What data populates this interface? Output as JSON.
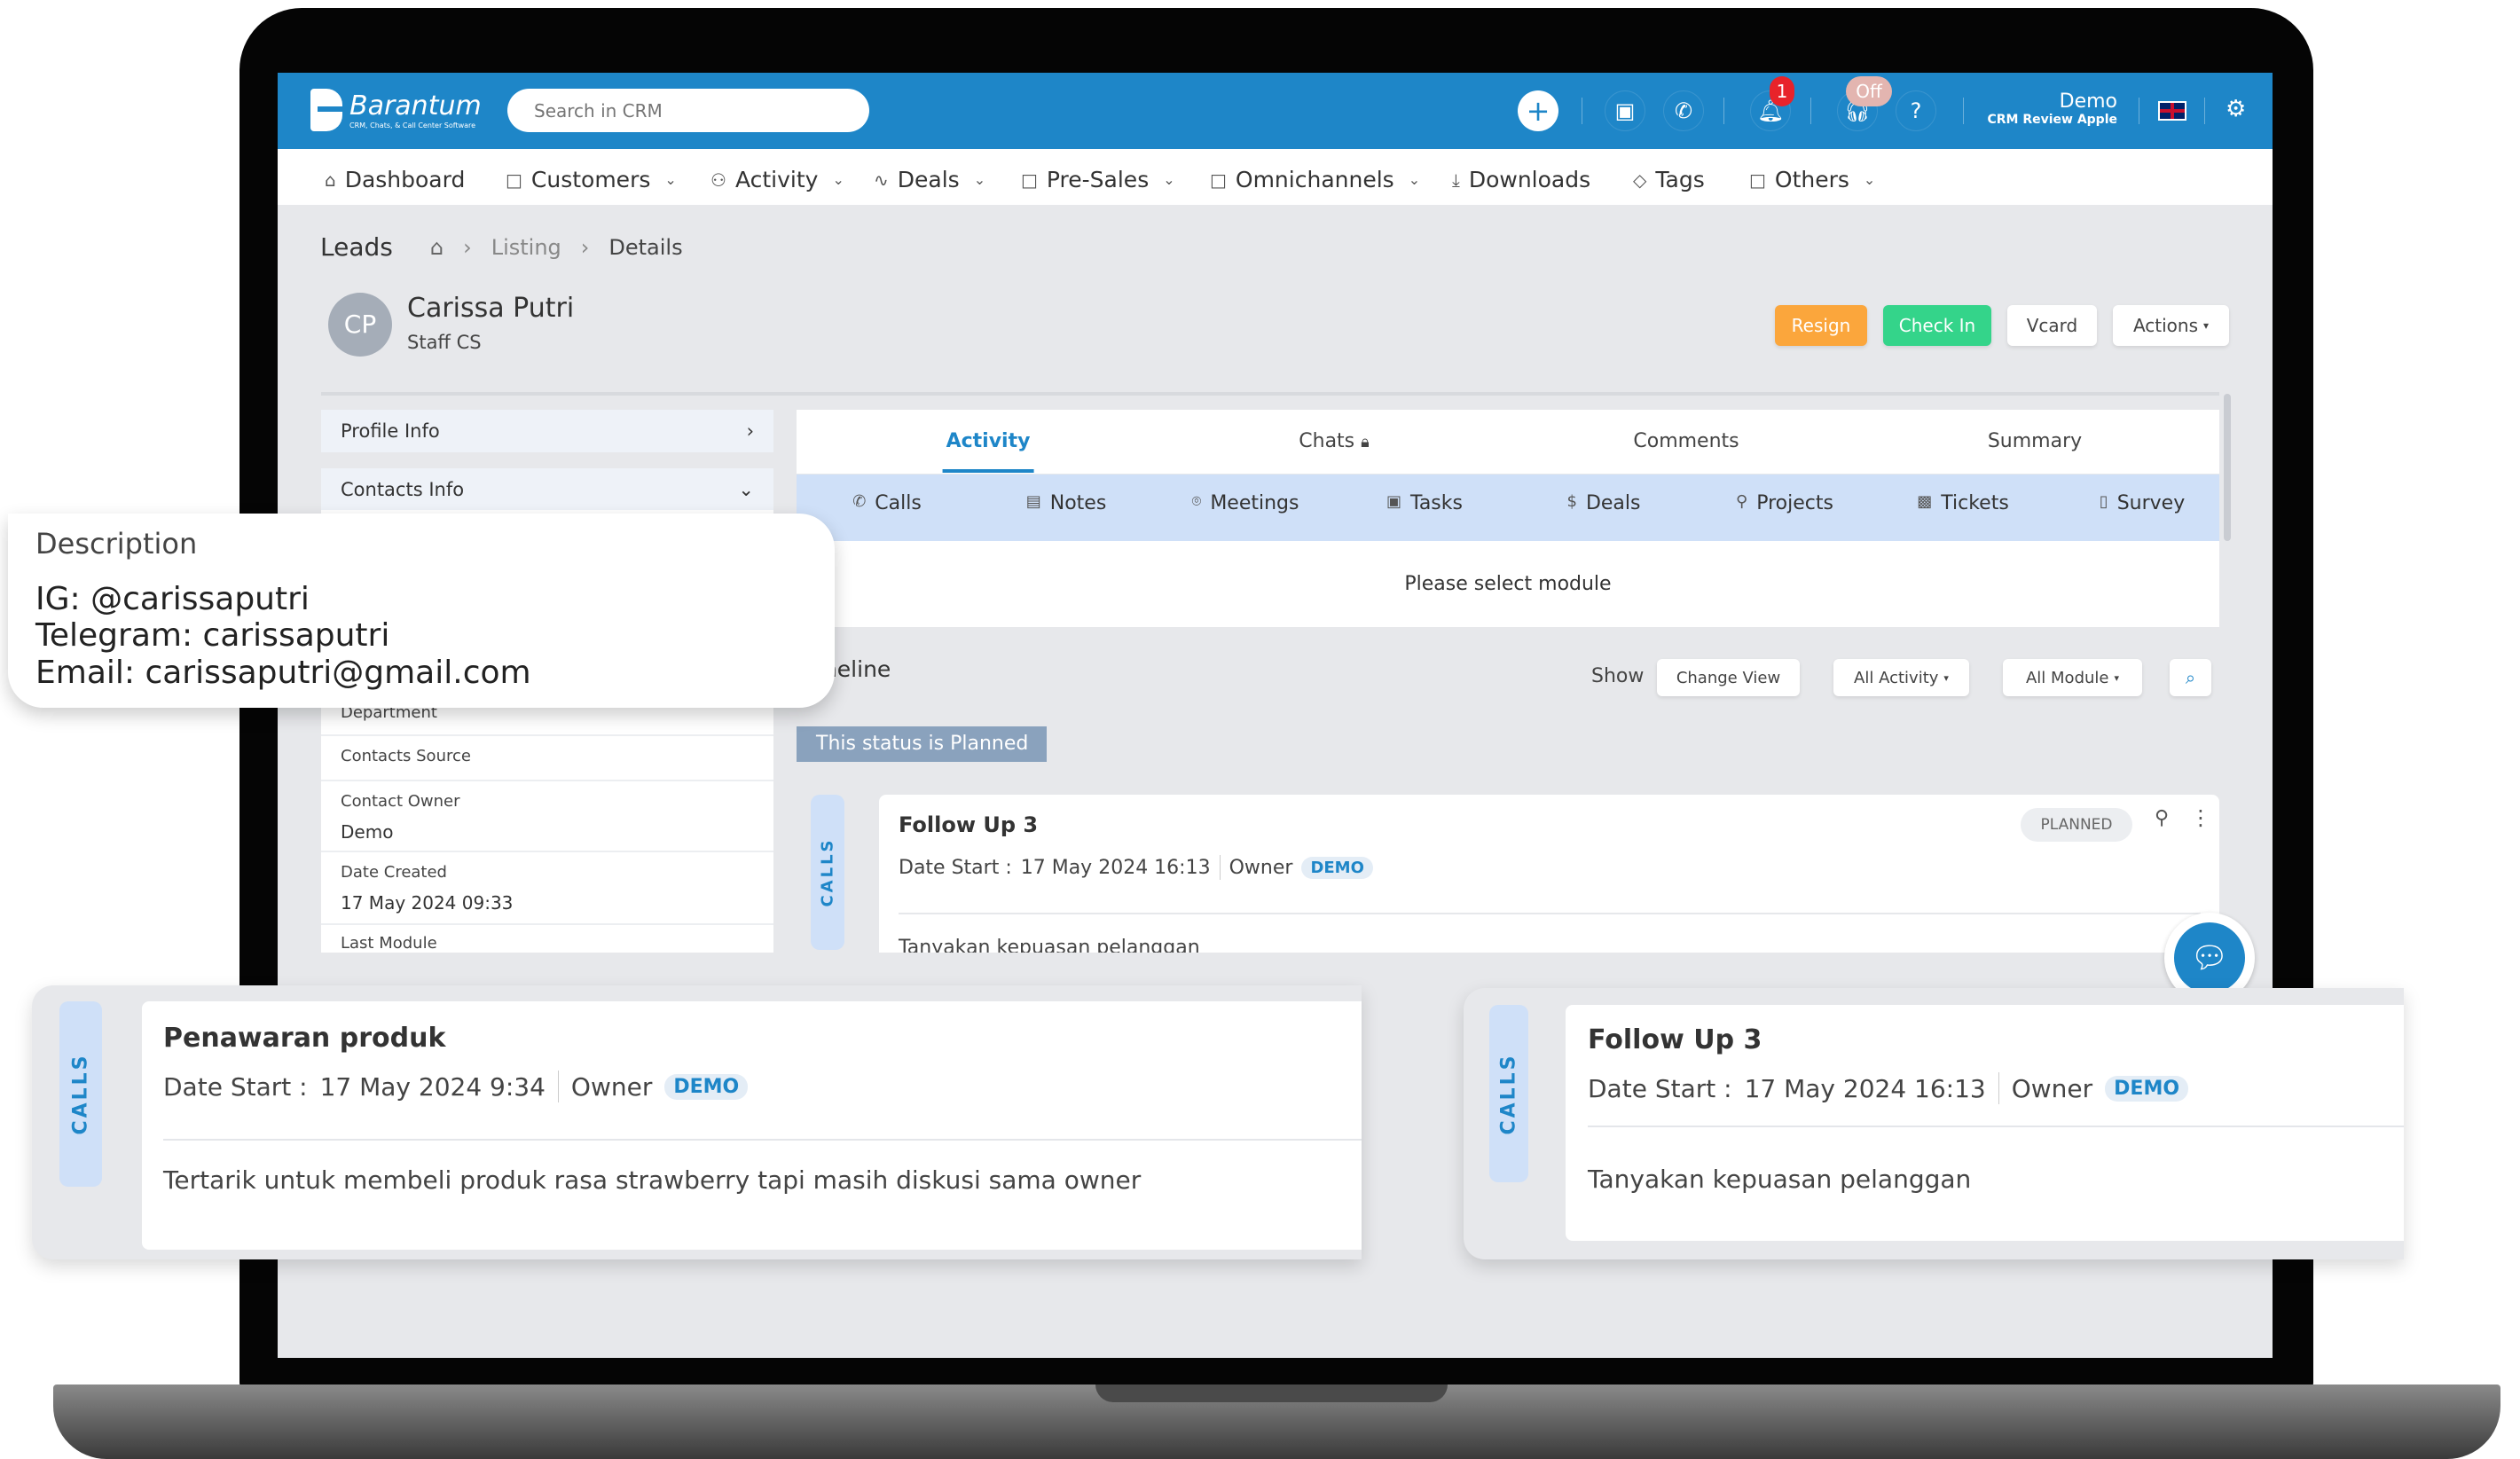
{
  "header": {
    "brand": "Barantum",
    "brand_tagline": "CRM, Chats, & Call Center Software",
    "search_placeholder": "Search in CRM",
    "notification_count": "1",
    "agent_status": "Off",
    "user_name": "Demo",
    "user_company": "CRM Review Apple",
    "accent": "#1e86c8"
  },
  "nav": {
    "items": [
      {
        "label": "Dashboard",
        "icon": "home-icon"
      },
      {
        "label": "Customers",
        "icon": "folder-icon"
      },
      {
        "label": "Activity",
        "icon": "users-icon"
      },
      {
        "label": "Deals",
        "icon": "pulse-icon"
      },
      {
        "label": "Pre-Sales",
        "icon": "folder-icon"
      },
      {
        "label": "Omnichannels",
        "icon": "folder-icon"
      },
      {
        "label": "Downloads",
        "icon": "download-icon"
      },
      {
        "label": "Tags",
        "icon": "tag-icon"
      },
      {
        "label": "Others",
        "icon": "folder-icon"
      }
    ]
  },
  "breadcrumb": {
    "section": "Leads",
    "listing": "Listing",
    "details": "Details"
  },
  "contact": {
    "initials": "CP",
    "name": "Carissa Putri",
    "role": "Staff CS"
  },
  "actions": {
    "resign": "Resign",
    "check_in": "Check In",
    "vcard": "Vcard",
    "actions": "Actions"
  },
  "sidebar": {
    "profile_info": "Profile Info",
    "contacts_info": "Contacts Info",
    "fields": [
      {
        "label": "Department",
        "value": ""
      },
      {
        "label": "Contacts Source",
        "value": ""
      },
      {
        "label": "Contact Owner",
        "value": "Demo"
      },
      {
        "label": "Date Created",
        "value": "17 May 2024 09:33"
      },
      {
        "label": "Last Module",
        "value": ""
      }
    ]
  },
  "tabs": [
    "Activity",
    "Chats",
    "Comments",
    "Summary"
  ],
  "subtabs": [
    {
      "label": "Calls",
      "icon": "phone-icon"
    },
    {
      "label": "Notes",
      "icon": "note-icon"
    },
    {
      "label": "Meetings",
      "icon": "location-icon"
    },
    {
      "label": "Tasks",
      "icon": "briefcase-icon"
    },
    {
      "label": "Deals",
      "icon": "dollar-icon"
    },
    {
      "label": "Projects",
      "icon": "org-icon"
    },
    {
      "label": "Tickets",
      "icon": "ticket-icon"
    },
    {
      "label": "Survey",
      "icon": "document-icon"
    }
  ],
  "module_prompt": "Please select module",
  "timeline": {
    "title": "Timeline",
    "show": "Show",
    "change_view": "Change View",
    "all_activity": "All Activity",
    "all_module": "All Module",
    "status_banner": "This status is Planned"
  },
  "activity_card": {
    "type": "CALLS",
    "title": "Follow Up 3",
    "date_label": "Date Start :",
    "date": "17 May 2024 16:13",
    "owner_label": "Owner",
    "owner": "DEMO",
    "status": "PLANNED",
    "description": "Tanyakan kepuasan pelanggan"
  },
  "description_popup": {
    "title": "Description",
    "lines": [
      "IG: @carissaputri",
      "Telegram: carissaputri",
      "Email: carissaputri@gmail.com"
    ]
  },
  "overlay_cards": [
    {
      "type": "CALLS",
      "title": "Penawaran produk",
      "date_label": "Date Start :",
      "date": "17 May 2024 9:34",
      "owner_label": "Owner",
      "owner": "DEMO",
      "description": "Tertarik untuk membeli produk rasa strawberry tapi masih diskusi sama owner"
    },
    {
      "type": "CALLS",
      "title": "Follow Up 3",
      "date_label": "Date Start :",
      "date": "17 May 2024 16:13",
      "owner_label": "Owner",
      "owner": "DEMO",
      "description": "Tanyakan kepuasan pelanggan"
    }
  ]
}
